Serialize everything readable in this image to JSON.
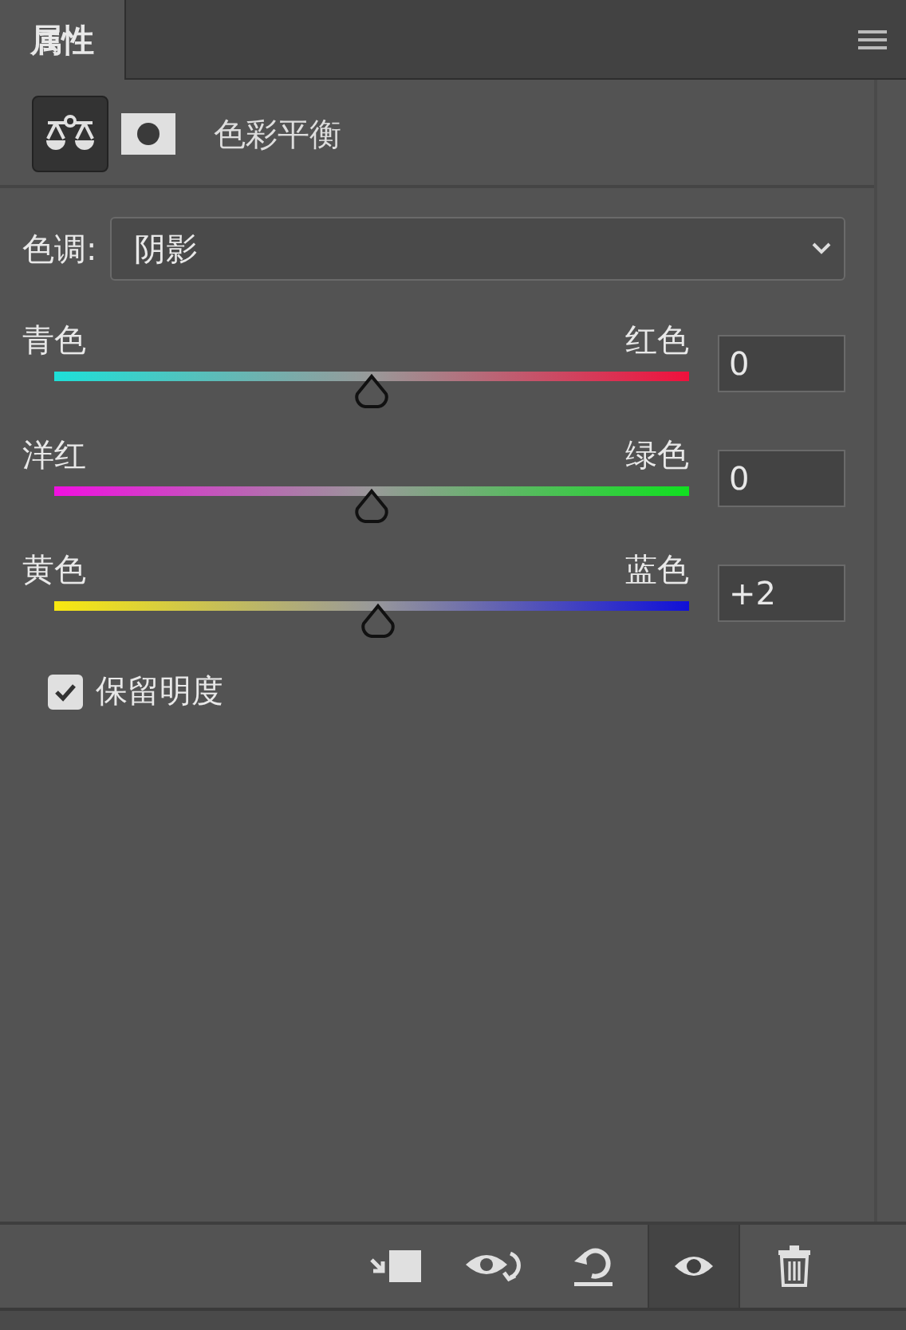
{
  "panel": {
    "tab": "属性",
    "adjustment_title": "色彩平衡"
  },
  "tone": {
    "label": "色调:",
    "value": "阴影"
  },
  "sliders": [
    {
      "left": "青色",
      "right": "红色",
      "level": 0.5,
      "value": "0"
    },
    {
      "left": "洋红",
      "right": "绿色",
      "level": 0.5,
      "value": "0"
    },
    {
      "left": "黄色",
      "right": "蓝色",
      "level": 0.51,
      "value": "+2"
    }
  ],
  "preserve_luminosity": {
    "label": "保留明度",
    "checked": true
  },
  "toolbar": [
    {
      "kind": "clip",
      "on": false
    },
    {
      "kind": "preview",
      "on": false
    },
    {
      "kind": "reset",
      "on": false
    },
    {
      "kind": "visibility",
      "on": true
    },
    {
      "kind": "delete",
      "on": false
    }
  ]
}
